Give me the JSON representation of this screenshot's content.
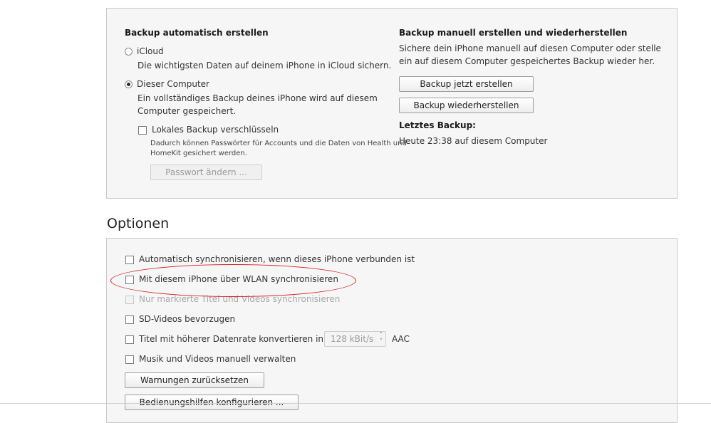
{
  "backup": {
    "auto_title": "Backup automatisch erstellen",
    "icloud_label": "iCloud",
    "icloud_desc": "Die wichtigsten Daten auf deinem iPhone in iCloud sichern.",
    "computer_label": "Dieser Computer",
    "computer_desc_line1": "Ein vollständiges Backup deines iPhone wird auf diesem",
    "computer_desc_line2": "Computer gespeichert.",
    "encrypt_label": "Lokales Backup verschlüsseln",
    "encrypt_desc_line1": "Dadurch können Passwörter für Accounts und die Daten von Health und",
    "encrypt_desc_line2": "HomeKit gesichert werden.",
    "change_password_label": "Passwort ändern ...",
    "manual_title": "Backup manuell erstellen und wiederherstellen",
    "manual_desc_line1": "Sichere dein iPhone manuell auf diesen Computer oder stelle",
    "manual_desc_line2": "ein auf diesem Computer gespeichertes Backup wieder her.",
    "backup_now_label": "Backup jetzt erstellen",
    "restore_label": "Backup wiederherstellen",
    "last_backup_title": "Letztes Backup:",
    "last_backup_value": "Heute 23:38 auf diesem Computer",
    "selected_option": "Dieser Computer"
  },
  "options": {
    "heading": "Optionen",
    "items": [
      {
        "label": "Automatisch synchronisieren, wenn dieses iPhone verbunden ist",
        "checked": false,
        "disabled": false
      },
      {
        "label": "Mit diesem iPhone über WLAN synchronisieren",
        "checked": false,
        "disabled": false
      },
      {
        "label": "Nur markierte Titel und Videos synchronisieren",
        "checked": false,
        "disabled": true
      },
      {
        "label": "SD-Videos bevorzugen",
        "checked": false,
        "disabled": false
      },
      {
        "label": "Titel mit höherer Datenrate konvertieren in",
        "checked": false,
        "disabled": false
      },
      {
        "label": "Musik und Videos manuell verwalten",
        "checked": false,
        "disabled": false
      }
    ],
    "bitrate_value": "128 kBit/s",
    "bitrate_format": "AAC",
    "reset_warnings_label": "Warnungen zurücksetzen",
    "accessibility_label": "Bedienungshilfen konfigurieren ..."
  },
  "colors": {
    "panel_bg": "#f6f6f6",
    "annotation": "#d42020"
  }
}
